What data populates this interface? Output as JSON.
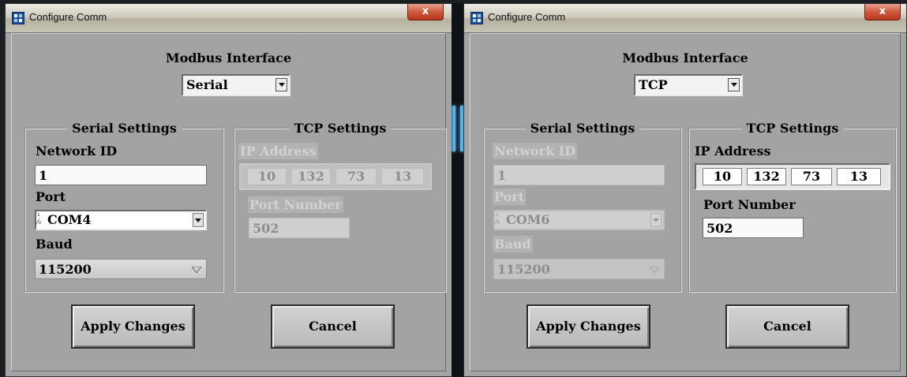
{
  "colors": {
    "dialog_bg": "#a3a3a3",
    "close_button": "#c94a2f",
    "accent_glow": "#52b3f0"
  },
  "windows": [
    {
      "title": "Configure Comm",
      "close_glyph": "x",
      "modbus_label": "Modbus Interface",
      "interface_selected": "Serial",
      "serial": {
        "legend": "Serial Settings",
        "network_id_label": "Network ID",
        "network_id_value": "1",
        "port_label": "Port",
        "port_value": "COM4",
        "baud_label": "Baud",
        "baud_value": "115200",
        "enabled": true
      },
      "tcp": {
        "legend": "TCP Settings",
        "ip_label": "IP Address",
        "ip": [
          "10",
          "132",
          "73",
          "13"
        ],
        "port_number_label": "Port Number",
        "port_number_value": "502",
        "enabled": false
      },
      "apply_label": "Apply Changes",
      "cancel_label": "Cancel"
    },
    {
      "title": "Configure Comm",
      "close_glyph": "x",
      "modbus_label": "Modbus Interface",
      "interface_selected": "TCP",
      "serial": {
        "legend": "Serial Settings",
        "network_id_label": "Network ID",
        "network_id_value": "1",
        "port_label": "Port",
        "port_value": "COM6",
        "baud_label": "Baud",
        "baud_value": "115200",
        "enabled": false
      },
      "tcp": {
        "legend": "TCP Settings",
        "ip_label": "IP Address",
        "ip": [
          "10",
          "132",
          "73",
          "13"
        ],
        "port_number_label": "Port Number",
        "port_number_value": "502",
        "enabled": true
      },
      "apply_label": "Apply Changes",
      "cancel_label": "Cancel"
    }
  ]
}
